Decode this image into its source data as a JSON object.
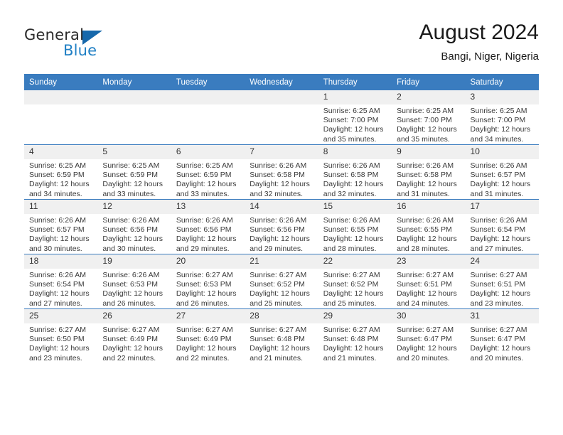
{
  "brand": {
    "name_part1": "General",
    "name_part2": "Blue",
    "flag_icon": "triangle-flag-icon"
  },
  "header": {
    "title": "August 2024",
    "subtitle": "Bangi, Niger, Nigeria"
  },
  "calendar": {
    "weekday_headers": [
      "Sunday",
      "Monday",
      "Tuesday",
      "Wednesday",
      "Thursday",
      "Friday",
      "Saturday"
    ],
    "colors": {
      "header_bar": "#3a7cbf",
      "daynum_band": "#f0f0f0",
      "brand_blue": "#1f7fc4",
      "text": "#3a3a3a"
    },
    "weeks": [
      [
        {
          "day": "",
          "empty": true
        },
        {
          "day": "",
          "empty": true
        },
        {
          "day": "",
          "empty": true
        },
        {
          "day": "",
          "empty": true
        },
        {
          "day": "1",
          "sunrise": "Sunrise: 6:25 AM",
          "sunset": "Sunset: 7:00 PM",
          "daylight": "Daylight: 12 hours and 35 minutes."
        },
        {
          "day": "2",
          "sunrise": "Sunrise: 6:25 AM",
          "sunset": "Sunset: 7:00 PM",
          "daylight": "Daylight: 12 hours and 35 minutes."
        },
        {
          "day": "3",
          "sunrise": "Sunrise: 6:25 AM",
          "sunset": "Sunset: 7:00 PM",
          "daylight": "Daylight: 12 hours and 34 minutes."
        }
      ],
      [
        {
          "day": "4",
          "sunrise": "Sunrise: 6:25 AM",
          "sunset": "Sunset: 6:59 PM",
          "daylight": "Daylight: 12 hours and 34 minutes."
        },
        {
          "day": "5",
          "sunrise": "Sunrise: 6:25 AM",
          "sunset": "Sunset: 6:59 PM",
          "daylight": "Daylight: 12 hours and 33 minutes."
        },
        {
          "day": "6",
          "sunrise": "Sunrise: 6:25 AM",
          "sunset": "Sunset: 6:59 PM",
          "daylight": "Daylight: 12 hours and 33 minutes."
        },
        {
          "day": "7",
          "sunrise": "Sunrise: 6:26 AM",
          "sunset": "Sunset: 6:58 PM",
          "daylight": "Daylight: 12 hours and 32 minutes."
        },
        {
          "day": "8",
          "sunrise": "Sunrise: 6:26 AM",
          "sunset": "Sunset: 6:58 PM",
          "daylight": "Daylight: 12 hours and 32 minutes."
        },
        {
          "day": "9",
          "sunrise": "Sunrise: 6:26 AM",
          "sunset": "Sunset: 6:58 PM",
          "daylight": "Daylight: 12 hours and 31 minutes."
        },
        {
          "day": "10",
          "sunrise": "Sunrise: 6:26 AM",
          "sunset": "Sunset: 6:57 PM",
          "daylight": "Daylight: 12 hours and 31 minutes."
        }
      ],
      [
        {
          "day": "11",
          "sunrise": "Sunrise: 6:26 AM",
          "sunset": "Sunset: 6:57 PM",
          "daylight": "Daylight: 12 hours and 30 minutes."
        },
        {
          "day": "12",
          "sunrise": "Sunrise: 6:26 AM",
          "sunset": "Sunset: 6:56 PM",
          "daylight": "Daylight: 12 hours and 30 minutes."
        },
        {
          "day": "13",
          "sunrise": "Sunrise: 6:26 AM",
          "sunset": "Sunset: 6:56 PM",
          "daylight": "Daylight: 12 hours and 29 minutes."
        },
        {
          "day": "14",
          "sunrise": "Sunrise: 6:26 AM",
          "sunset": "Sunset: 6:56 PM",
          "daylight": "Daylight: 12 hours and 29 minutes."
        },
        {
          "day": "15",
          "sunrise": "Sunrise: 6:26 AM",
          "sunset": "Sunset: 6:55 PM",
          "daylight": "Daylight: 12 hours and 28 minutes."
        },
        {
          "day": "16",
          "sunrise": "Sunrise: 6:26 AM",
          "sunset": "Sunset: 6:55 PM",
          "daylight": "Daylight: 12 hours and 28 minutes."
        },
        {
          "day": "17",
          "sunrise": "Sunrise: 6:26 AM",
          "sunset": "Sunset: 6:54 PM",
          "daylight": "Daylight: 12 hours and 27 minutes."
        }
      ],
      [
        {
          "day": "18",
          "sunrise": "Sunrise: 6:26 AM",
          "sunset": "Sunset: 6:54 PM",
          "daylight": "Daylight: 12 hours and 27 minutes."
        },
        {
          "day": "19",
          "sunrise": "Sunrise: 6:26 AM",
          "sunset": "Sunset: 6:53 PM",
          "daylight": "Daylight: 12 hours and 26 minutes."
        },
        {
          "day": "20",
          "sunrise": "Sunrise: 6:27 AM",
          "sunset": "Sunset: 6:53 PM",
          "daylight": "Daylight: 12 hours and 26 minutes."
        },
        {
          "day": "21",
          "sunrise": "Sunrise: 6:27 AM",
          "sunset": "Sunset: 6:52 PM",
          "daylight": "Daylight: 12 hours and 25 minutes."
        },
        {
          "day": "22",
          "sunrise": "Sunrise: 6:27 AM",
          "sunset": "Sunset: 6:52 PM",
          "daylight": "Daylight: 12 hours and 25 minutes."
        },
        {
          "day": "23",
          "sunrise": "Sunrise: 6:27 AM",
          "sunset": "Sunset: 6:51 PM",
          "daylight": "Daylight: 12 hours and 24 minutes."
        },
        {
          "day": "24",
          "sunrise": "Sunrise: 6:27 AM",
          "sunset": "Sunset: 6:51 PM",
          "daylight": "Daylight: 12 hours and 23 minutes."
        }
      ],
      [
        {
          "day": "25",
          "sunrise": "Sunrise: 6:27 AM",
          "sunset": "Sunset: 6:50 PM",
          "daylight": "Daylight: 12 hours and 23 minutes."
        },
        {
          "day": "26",
          "sunrise": "Sunrise: 6:27 AM",
          "sunset": "Sunset: 6:49 PM",
          "daylight": "Daylight: 12 hours and 22 minutes."
        },
        {
          "day": "27",
          "sunrise": "Sunrise: 6:27 AM",
          "sunset": "Sunset: 6:49 PM",
          "daylight": "Daylight: 12 hours and 22 minutes."
        },
        {
          "day": "28",
          "sunrise": "Sunrise: 6:27 AM",
          "sunset": "Sunset: 6:48 PM",
          "daylight": "Daylight: 12 hours and 21 minutes."
        },
        {
          "day": "29",
          "sunrise": "Sunrise: 6:27 AM",
          "sunset": "Sunset: 6:48 PM",
          "daylight": "Daylight: 12 hours and 21 minutes."
        },
        {
          "day": "30",
          "sunrise": "Sunrise: 6:27 AM",
          "sunset": "Sunset: 6:47 PM",
          "daylight": "Daylight: 12 hours and 20 minutes."
        },
        {
          "day": "31",
          "sunrise": "Sunrise: 6:27 AM",
          "sunset": "Sunset: 6:47 PM",
          "daylight": "Daylight: 12 hours and 20 minutes."
        }
      ]
    ]
  }
}
